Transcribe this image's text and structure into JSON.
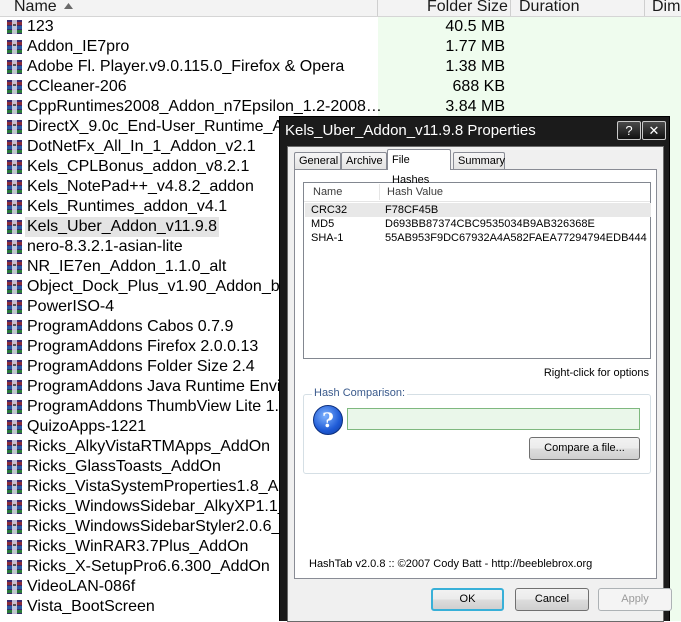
{
  "explorer": {
    "columns": {
      "name": "Name",
      "folder_size": "Folder Size",
      "duration": "Duration",
      "dim": "Dim"
    },
    "rows": [
      {
        "name": "123",
        "size": "40.5 MB"
      },
      {
        "name": "Addon_IE7pro",
        "size": "1.77 MB"
      },
      {
        "name": "Adobe Fl. Player.v9.0.115.0_Firefox & Opera",
        "size": "1.38 MB"
      },
      {
        "name": "CCleaner-206",
        "size": "688 KB"
      },
      {
        "name": "CppRuntimes2008_Addon_n7Epsilon_1.2-2008…",
        "size": "3.84 MB"
      },
      {
        "name": "DirectX_9.0c_End-User_Runtime_Ad",
        "size": ""
      },
      {
        "name": "DotNetFx_All_In_1_Addon_v2.1",
        "size": ""
      },
      {
        "name": "Kels_CPLBonus_addon_v8.2.1",
        "size": ""
      },
      {
        "name": "Kels_NotePad++_v4.8.2_addon",
        "size": ""
      },
      {
        "name": "Kels_Runtimes_addon_v4.1",
        "size": ""
      },
      {
        "name": "Kels_Uber_Addon_v11.9.8",
        "size": "",
        "selected": true
      },
      {
        "name": "nero-8.3.2.1-asian-lite",
        "size": ""
      },
      {
        "name": "NR_IE7en_Addon_1.1.0_alt",
        "size": ""
      },
      {
        "name": "Object_Dock_Plus_v1.90_Addon_by",
        "size": ""
      },
      {
        "name": "PowerISO-4",
        "size": ""
      },
      {
        "name": "ProgramAddons Cabos 0.7.9",
        "size": ""
      },
      {
        "name": "ProgramAddons Firefox 2.0.0.13",
        "size": ""
      },
      {
        "name": "ProgramAddons Folder Size 2.4",
        "size": ""
      },
      {
        "name": "ProgramAddons Java Runtime Envir",
        "size": ""
      },
      {
        "name": "ProgramAddons ThumbView Lite 1.0",
        "size": ""
      },
      {
        "name": "QuizoApps-1221",
        "size": ""
      },
      {
        "name": "Ricks_AlkyVistaRTMApps_AddOn",
        "size": ""
      },
      {
        "name": "Ricks_GlassToasts_AddOn",
        "size": ""
      },
      {
        "name": "Ricks_VistaSystemProperties1.8_Add",
        "size": ""
      },
      {
        "name": "Ricks_WindowsSidebar_AlkyXP1.1_A",
        "size": ""
      },
      {
        "name": "Ricks_WindowsSidebarStyler2.0.6_A",
        "size": ""
      },
      {
        "name": "Ricks_WinRAR3.7Plus_AddOn",
        "size": ""
      },
      {
        "name": "Ricks_X-SetupPro6.6.300_AddOn",
        "size": ""
      },
      {
        "name": "VideoLAN-086f",
        "size": ""
      },
      {
        "name": "Vista_BootScreen",
        "size": ""
      }
    ]
  },
  "dialog": {
    "title": "Kels_Uber_Addon_v11.9.8 Properties",
    "help_button": "?",
    "close_button": "✕",
    "tabs": [
      {
        "label": "General"
      },
      {
        "label": "Archive"
      },
      {
        "label": "File Hashes",
        "active": true
      },
      {
        "label": "Summary"
      }
    ],
    "hash_list": {
      "col_name": "Name",
      "col_value": "Hash Value",
      "rows": [
        {
          "name": "CRC32",
          "value": "F78CF45B"
        },
        {
          "name": "MD5",
          "value": "D693BB87374CBC9535034B9AB326368E"
        },
        {
          "name": "SHA-1",
          "value": "55AB953F9DC67932A4A582FAEA77294794EDB444"
        }
      ]
    },
    "hint": "Right-click for options",
    "comparison": {
      "label": "Hash Comparison:",
      "icon": "?",
      "input_value": "",
      "compare_button": "Compare a file..."
    },
    "footer": "HashTab v2.0.8 :: ©2007 Cody Batt  -  http://beeblebrox.org",
    "buttons": {
      "ok": "OK",
      "cancel": "Cancel",
      "apply": "Apply"
    }
  },
  "colors": {
    "size_band": "#effcee",
    "dialog_frame": "#1b1b1b",
    "ok_focus": "#38b0d8"
  },
  "icons": {
    "file": "winrar-archive-icon",
    "question": "question-icon"
  }
}
